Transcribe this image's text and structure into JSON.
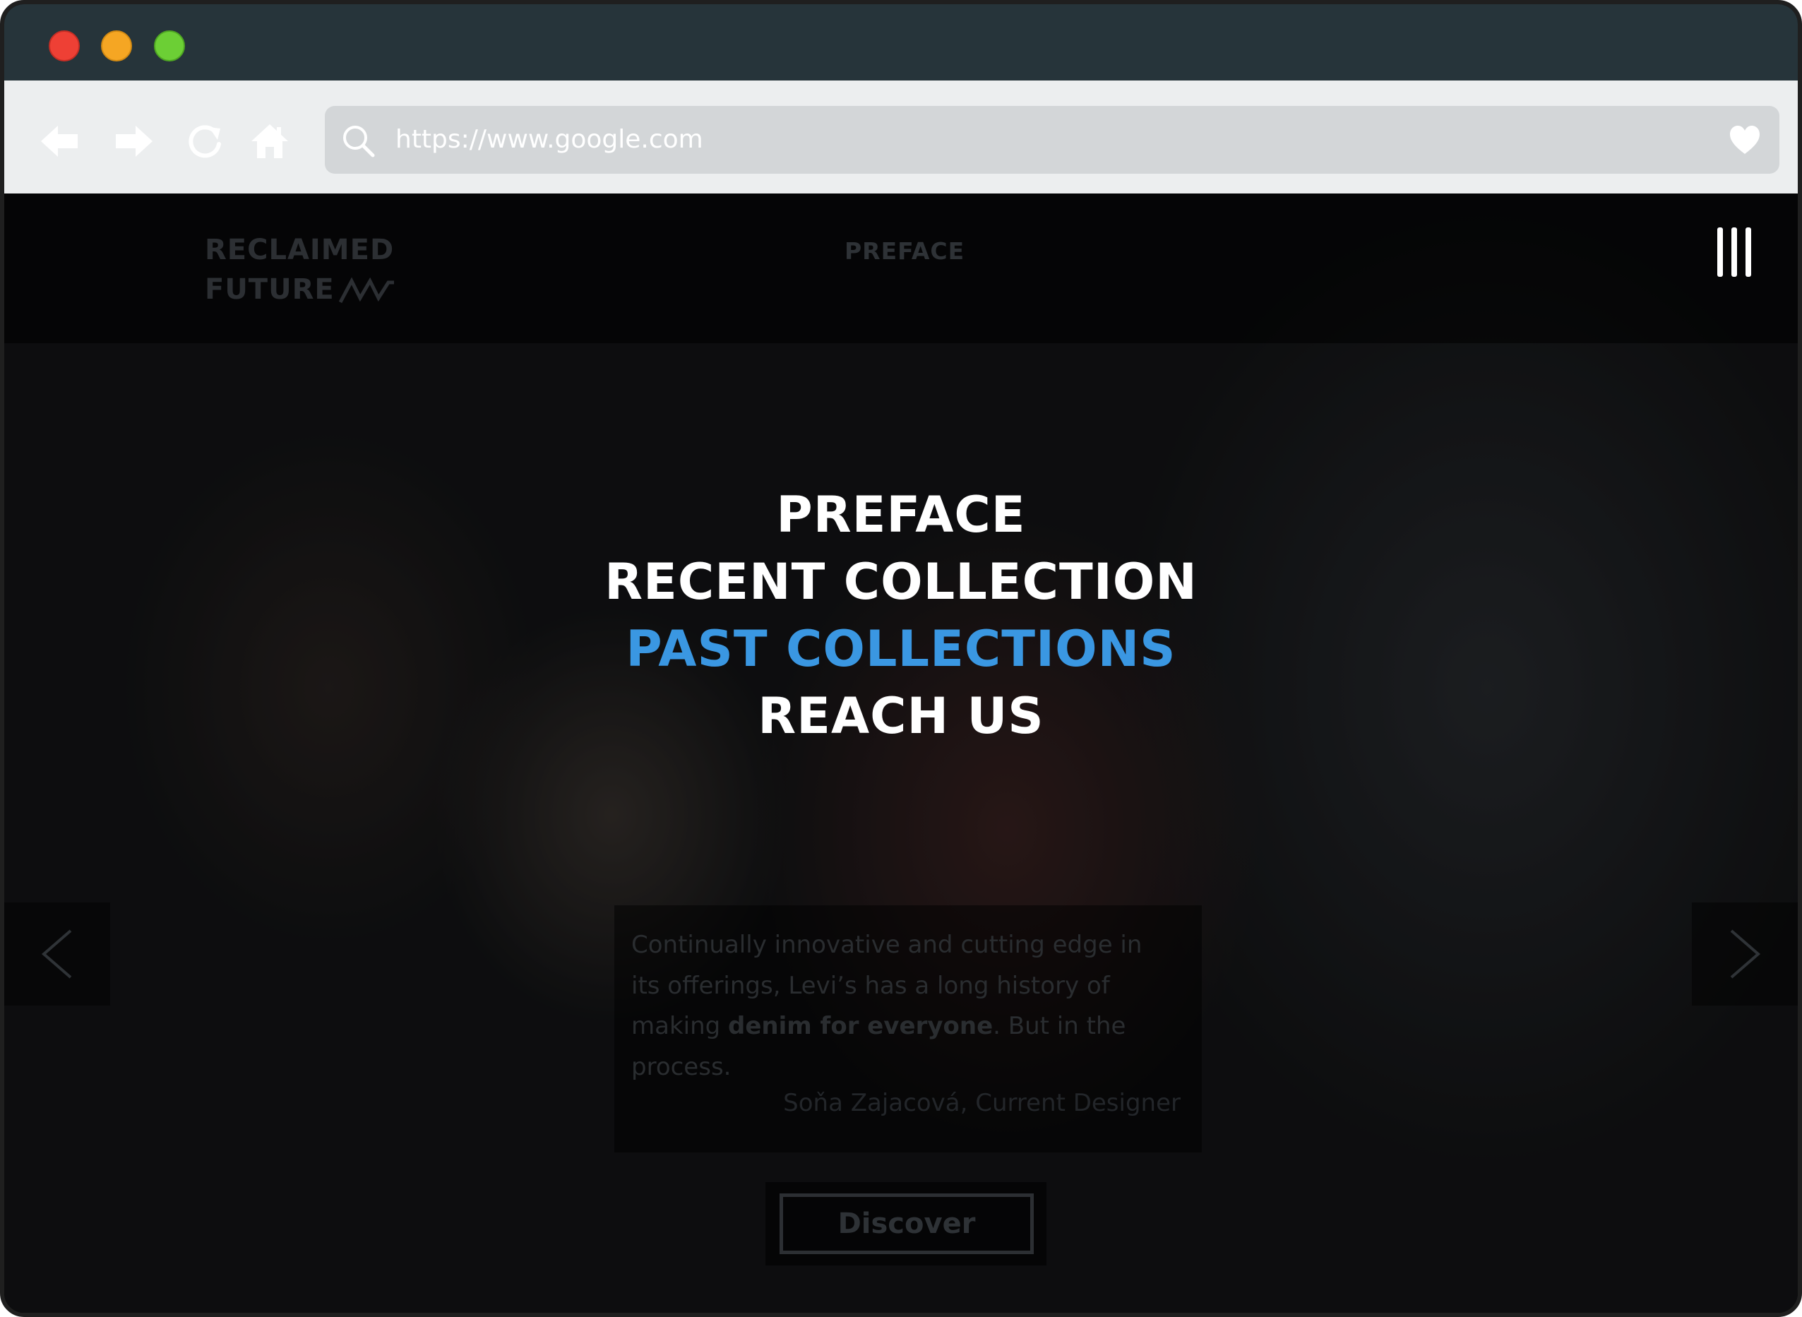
{
  "browser": {
    "url": "https://www.google.com"
  },
  "site": {
    "brand_line1": "RECLAIMED",
    "brand_line2": "FUTURE",
    "header_nav": "PREFACE"
  },
  "menu": {
    "items": [
      {
        "label": "PREFACE"
      },
      {
        "label": "RECENT COLLECTION"
      },
      {
        "label": "PAST COLLECTIONS"
      },
      {
        "label": "REACH US"
      }
    ]
  },
  "quote": {
    "part1": "Continually innovative and cutting edge in its offerings, Levi’s has a long history of making ",
    "bold": "denim for everyone",
    "part2": ". But in the process.",
    "author": "Soňa Zajacová, Current Designer"
  },
  "cta": {
    "discover_label": "Discover"
  },
  "colors": {
    "active_menu": "#3a97e2",
    "titlebar": "#26343a",
    "toolbar": "#eceeef"
  }
}
